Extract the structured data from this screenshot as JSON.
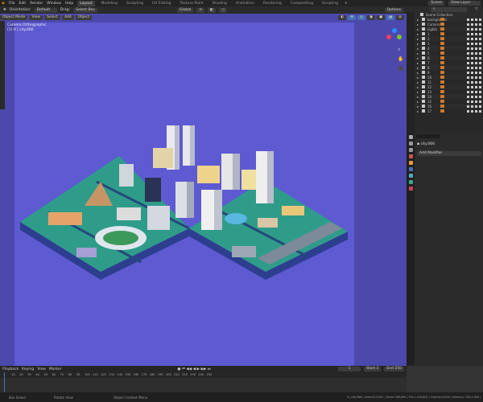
{
  "menu": [
    "File",
    "Edit",
    "Render",
    "Window",
    "Help"
  ],
  "workspaces": [
    "Layout",
    "Modeling",
    "Sculpting",
    "UV Editing",
    "Texture Paint",
    "Shading",
    "Animation",
    "Rendering",
    "Compositing",
    "Scripting"
  ],
  "active_workspace": "Layout",
  "scene": {
    "label": "Scene",
    "view_layer": "View Layer"
  },
  "header": {
    "orientation_label": "Orientation:",
    "orientation": "Default",
    "drag_label": "Drag:",
    "drag": "Select Box",
    "transform": "Global",
    "options": "Options"
  },
  "viewport": {
    "mode": "Object Mode",
    "menus": [
      "View",
      "Select",
      "Add",
      "Object"
    ],
    "camera_label": "Camera Orthographic",
    "object_label": "(1) 9 | city.066"
  },
  "outliner": {
    "root": "Scene Collection",
    "items": [
      "background",
      "Camera",
      "Lights",
      "1",
      "2",
      "3",
      "4",
      "5",
      "6",
      "7",
      "8",
      "9",
      "10",
      "11",
      "12",
      "13",
      "14",
      "15",
      "16",
      "17"
    ]
  },
  "properties": {
    "object": "city.066",
    "add_modifier": "Add Modifier"
  },
  "timeline": {
    "menus": [
      "Playback",
      "Keying",
      "View",
      "Marker"
    ],
    "current_frame": "1",
    "start_label": "Start",
    "start": "1",
    "end_label": "End",
    "end": "250",
    "ticks": [
      "1",
      "10",
      "20",
      "30",
      "40",
      "50",
      "60",
      "70",
      "80",
      "90",
      "100",
      "110",
      "120",
      "130",
      "140",
      "150",
      "160",
      "170",
      "180",
      "190",
      "200",
      "210",
      "220",
      "230",
      "240",
      "250"
    ]
  },
  "status": {
    "select": "Box Select",
    "rotate": "Rotate View",
    "context": "Object Context Menu",
    "stats": "9 | city.066 | Verts:813,591 | Faces:768,690 | Tris:1,418,802 | Objects:0/346 | Memory: 763.3 MiB |"
  },
  "colors": {
    "viewport_bg": "#4c48ac",
    "camera_bg": "#5e5ad2",
    "platform_top": "#2f9c8a",
    "platform_side": "#2d3e8f",
    "accent": "#4772b3"
  }
}
